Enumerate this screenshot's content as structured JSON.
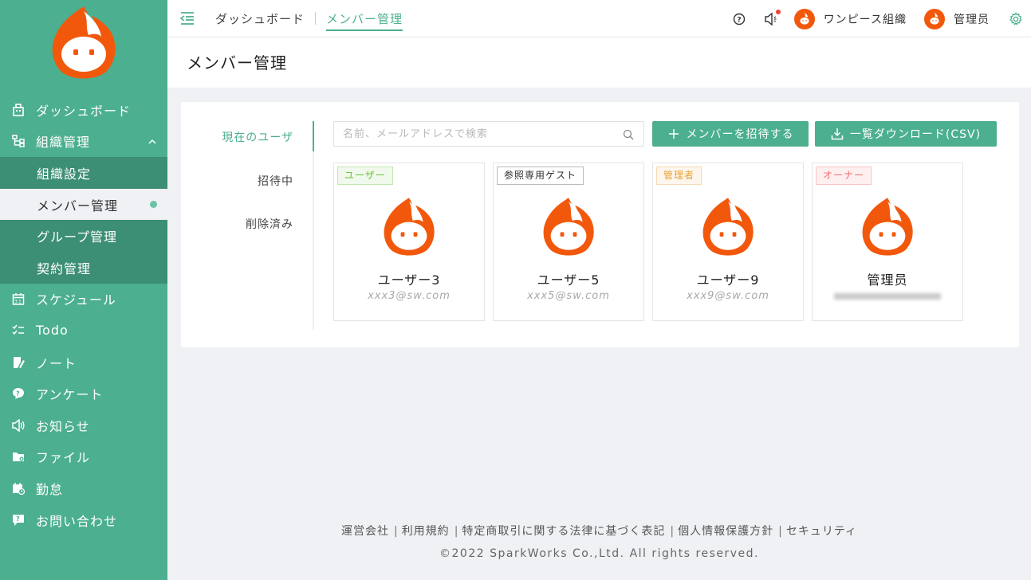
{
  "colors": {
    "primary": "#4caf8f",
    "logo_orange": "#f2580c"
  },
  "sidebar": {
    "logo": "flame-mascot-logo",
    "items": [
      {
        "label": "ダッシュボード",
        "icon": "dashboard-icon"
      },
      {
        "label": "組織管理",
        "icon": "org-icon",
        "expanded": true,
        "children": [
          {
            "label": "組織設定"
          },
          {
            "label": "メンバー管理",
            "active": true
          },
          {
            "label": "グループ管理"
          },
          {
            "label": "契約管理"
          }
        ]
      },
      {
        "label": "スケジュール",
        "icon": "calendar-icon"
      },
      {
        "label": "Todo",
        "icon": "checklist-icon"
      },
      {
        "label": "ノート",
        "icon": "note-icon"
      },
      {
        "label": "アンケート",
        "icon": "survey-icon"
      },
      {
        "label": "お知らせ",
        "icon": "speaker-icon"
      },
      {
        "label": "ファイル",
        "icon": "folder-icon"
      },
      {
        "label": "勤怠",
        "icon": "attendance-icon"
      },
      {
        "label": "お問い合わせ",
        "icon": "chat-question-icon"
      }
    ]
  },
  "header": {
    "breadcrumbs": [
      "ダッシュボード",
      "メンバー管理"
    ],
    "org_name": "ワンピース組織",
    "user_name": "管理员"
  },
  "page": {
    "title": "メンバー管理",
    "tabs": [
      "現在のユーザ",
      "招待中",
      "削除済み"
    ],
    "search_placeholder": "名前、メールアドレスで検索",
    "invite_button": "メンバーを招待する",
    "download_button": "一覧ダウンロード(CSV)",
    "members": [
      {
        "role": "ユーザー",
        "name": "ユーザー3",
        "email": "xxx3@sw.com"
      },
      {
        "role": "参照専用ゲスト",
        "name": "ユーザー5",
        "email": "xxx5@sw.com"
      },
      {
        "role": "管理者",
        "name": "ユーザー9",
        "email": "xxx9@sw.com"
      },
      {
        "role": "オーナー",
        "name": "管理员",
        "email": ""
      }
    ]
  },
  "footer": {
    "links": [
      "運営会社",
      "利用規約",
      "特定商取引に関する法律に基づく表記",
      "個人情報保護方針",
      "セキュリティ"
    ],
    "copyright": "©2022 SparkWorks Co.,Ltd. All rights reserved."
  }
}
